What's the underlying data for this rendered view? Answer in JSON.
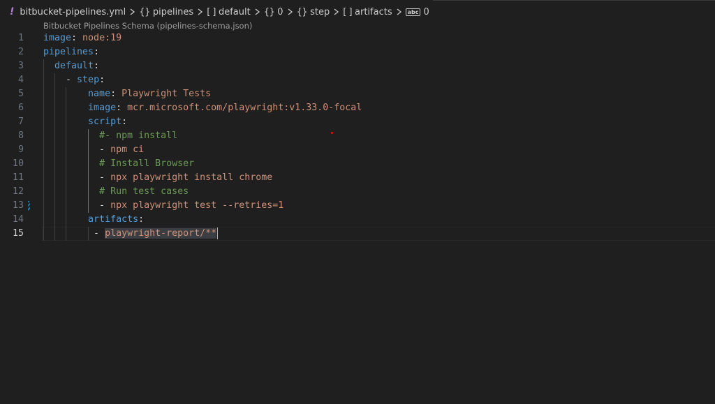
{
  "breadcrumb": {
    "file": "bitbucket-pipelines.yml",
    "items": [
      {
        "symbol": "{}",
        "label": "pipelines"
      },
      {
        "symbol": "[ ]",
        "label": "default"
      },
      {
        "symbol": "{}",
        "label": "0"
      },
      {
        "symbol": "{}",
        "label": "step"
      },
      {
        "symbol": "[ ]",
        "label": "artifacts"
      },
      {
        "symbol": "abc",
        "label": "0"
      }
    ]
  },
  "schema_label": "Bitbucket Pipelines Schema (pipelines-schema.json)",
  "editor": {
    "current_line": 15,
    "lines": [
      {
        "num": "1",
        "tokens": [
          [
            "k",
            "image"
          ],
          [
            "p",
            ": "
          ],
          [
            "s",
            "node:19"
          ]
        ]
      },
      {
        "num": "2",
        "tokens": [
          [
            "k",
            "pipelines"
          ],
          [
            "p",
            ":"
          ]
        ]
      },
      {
        "num": "3",
        "tokens": [
          [
            "p",
            "  "
          ],
          [
            "k",
            "default"
          ],
          [
            "p",
            ":"
          ]
        ]
      },
      {
        "num": "4",
        "tokens": [
          [
            "p",
            "    - "
          ],
          [
            "k",
            "step"
          ],
          [
            "p",
            ":"
          ]
        ]
      },
      {
        "num": "5",
        "tokens": [
          [
            "p",
            "        "
          ],
          [
            "k",
            "name"
          ],
          [
            "p",
            ": "
          ],
          [
            "s",
            "Playwright Tests"
          ]
        ]
      },
      {
        "num": "6",
        "tokens": [
          [
            "p",
            "        "
          ],
          [
            "k",
            "image"
          ],
          [
            "p",
            ": "
          ],
          [
            "s",
            "mcr.microsoft.com/playwright:v1.33.0-focal"
          ]
        ]
      },
      {
        "num": "7",
        "tokens": [
          [
            "p",
            "        "
          ],
          [
            "k",
            "script"
          ],
          [
            "p",
            ":"
          ]
        ]
      },
      {
        "num": "8",
        "tokens": [
          [
            "p",
            "          "
          ],
          [
            "c",
            "#- npm install"
          ]
        ]
      },
      {
        "num": "9",
        "tokens": [
          [
            "p",
            "          - "
          ],
          [
            "s",
            "npm ci"
          ]
        ]
      },
      {
        "num": "10",
        "tokens": [
          [
            "p",
            "          "
          ],
          [
            "c",
            "# Install Browser"
          ]
        ]
      },
      {
        "num": "11",
        "tokens": [
          [
            "p",
            "          - "
          ],
          [
            "s",
            "npx playwright install chrome"
          ]
        ]
      },
      {
        "num": "12",
        "tokens": [
          [
            "p",
            "          "
          ],
          [
            "c",
            "# Run test cases"
          ]
        ]
      },
      {
        "num": "13",
        "tokens": [
          [
            "p",
            "          - "
          ],
          [
            "s",
            "npx playwright test --retries=1"
          ]
        ]
      },
      {
        "num": "14",
        "tokens": [
          [
            "p",
            "        "
          ],
          [
            "k",
            "artifacts"
          ],
          [
            "p",
            ":"
          ]
        ]
      },
      {
        "num": "15",
        "tokens": [
          [
            "p",
            "         - "
          ],
          [
            "sel",
            "playwright-report/**"
          ]
        ]
      }
    ]
  }
}
